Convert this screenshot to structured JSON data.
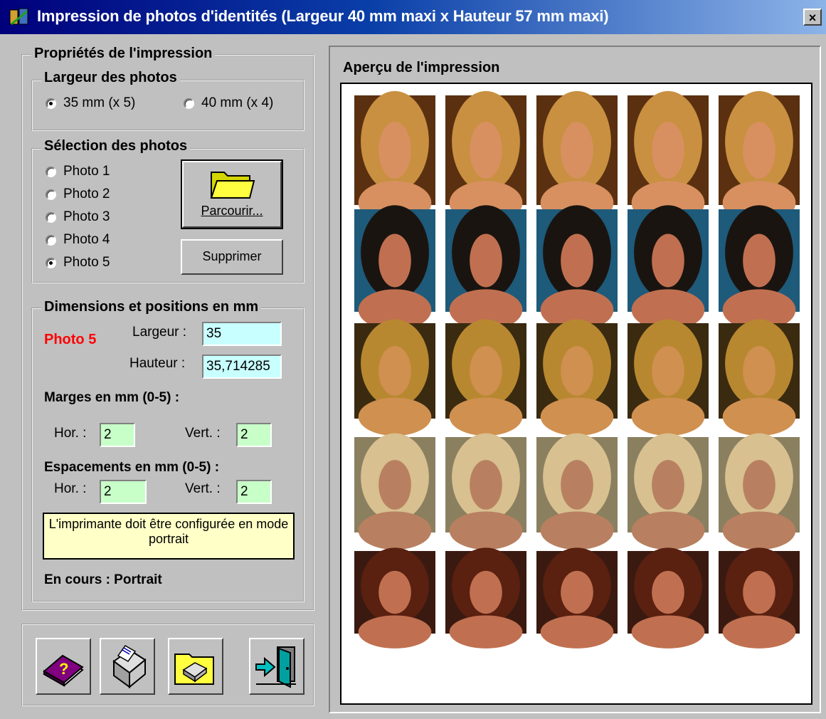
{
  "window": {
    "title": "Impression de photos d'identités (Largeur 40 mm maxi x Hauteur 57 mm maxi)",
    "close_label": "×"
  },
  "properties": {
    "legend": "Propriétés de l'impression",
    "width_group": {
      "legend": "Largeur des photos",
      "options": [
        {
          "label": "35 mm (x 5)",
          "selected": true
        },
        {
          "label": "40 mm (x 4)",
          "selected": false
        }
      ]
    },
    "selection_group": {
      "legend": "Sélection des photos",
      "photos": [
        {
          "label": "Photo 1",
          "selected": false
        },
        {
          "label": "Photo 2",
          "selected": false
        },
        {
          "label": "Photo 3",
          "selected": false
        },
        {
          "label": "Photo 4",
          "selected": false
        },
        {
          "label": "Photo 5",
          "selected": true
        }
      ],
      "browse_label": "Parcourir...",
      "delete_label": "Supprimer"
    },
    "dimensions_group": {
      "legend": "Dimensions et positions en mm",
      "current_photo": "Photo 5",
      "current_photo_color": "#ff0000",
      "width_label": "Largeur :",
      "width_value": "35",
      "height_label": "Hauteur :",
      "height_value": "35,714285",
      "margins_title": "Marges en mm (0-5) :",
      "margin_hor_label": "Hor. :",
      "margin_hor_value": "2",
      "margin_vert_label": "Vert. :",
      "margin_vert_value": "2",
      "spacing_title": "Espacements en mm (0-5) :",
      "spacing_hor_label": "Hor. :",
      "spacing_hor_value": "2",
      "spacing_vert_label": "Vert. :",
      "spacing_vert_value": "2",
      "notice": "L'imprimante doit être configurée en mode portrait",
      "status": "En cours : Portrait"
    }
  },
  "toolbar": {
    "buttons": [
      {
        "name": "help",
        "icon": "help-book-icon"
      },
      {
        "name": "printer",
        "icon": "printer-icon"
      },
      {
        "name": "printer-setup",
        "icon": "printer-setup-icon"
      },
      {
        "name": "exit",
        "icon": "exit-door-icon"
      }
    ]
  },
  "preview": {
    "title": "Aperçu de l'impression",
    "columns": 5,
    "rows": [
      {
        "photo": "Photo 1",
        "palette": {
          "bg": "#5a3010",
          "hair": "#c89040",
          "skin": "#d89060"
        }
      },
      {
        "photo": "Photo 2",
        "palette": {
          "bg": "#1e5a7a",
          "hair": "#1a1410",
          "skin": "#c07050"
        }
      },
      {
        "photo": "Photo 3",
        "palette": {
          "bg": "#3a2a10",
          "hair": "#b88830",
          "skin": "#d09050"
        }
      },
      {
        "photo": "Photo 4",
        "palette": {
          "bg": "#8a8060",
          "hair": "#d8c090",
          "skin": "#b88060"
        }
      },
      {
        "photo": "Photo 5",
        "palette": {
          "bg": "#3a1a10",
          "hair": "#5a2010",
          "skin": "#c07050"
        }
      }
    ]
  },
  "colors": {
    "face": "#c0c0c0",
    "field_cyan": "#c8ffff",
    "field_green": "#c8ffc8",
    "notice_bg": "#ffffc8"
  }
}
